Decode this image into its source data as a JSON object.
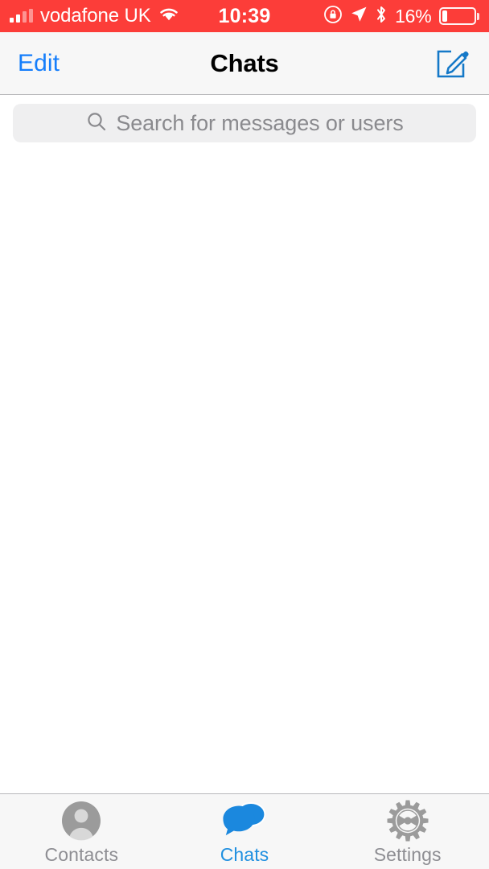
{
  "status_bar": {
    "carrier": "vodafone UK",
    "signal_icon": "signal-bars-icon",
    "signal_bars_filled": 2,
    "signal_bars_total": 4,
    "wifi_icon": "wifi-icon",
    "time": "10:39",
    "rotation_lock_icon": "rotation-lock-icon",
    "location_icon": "location-arrow-icon",
    "bluetooth_icon": "bluetooth-icon",
    "battery_percent_label": "16%",
    "battery_level": 16,
    "background_color": "#fc3d39",
    "foreground_color": "#ffffff"
  },
  "nav_bar": {
    "edit_label": "Edit",
    "title": "Chats",
    "compose_icon": "compose-icon",
    "accent_color": "#157efb",
    "background_color": "#f7f7f7"
  },
  "search": {
    "placeholder": "Search for messages or users",
    "value": "",
    "icon": "search-icon",
    "background_color": "#efeff0"
  },
  "content": {
    "empty": true,
    "background_color": "#ffffff"
  },
  "tab_bar": {
    "background_color": "#f7f7f7",
    "active_color": "#2090e0",
    "inactive_color": "#8e8e93",
    "items": [
      {
        "label": "Contacts",
        "icon": "contacts-person-icon",
        "active": false
      },
      {
        "label": "Chats",
        "icon": "chats-bubbles-icon",
        "active": true
      },
      {
        "label": "Settings",
        "icon": "settings-gear-icon",
        "active": false
      }
    ]
  }
}
